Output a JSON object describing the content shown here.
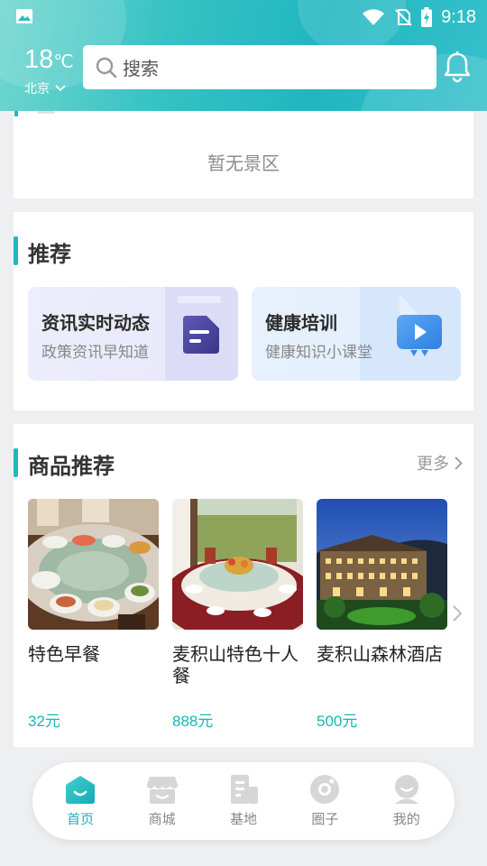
{
  "status_bar": {
    "time": "9:18"
  },
  "weather": {
    "temperature": "18",
    "unit": "℃",
    "city": "北京"
  },
  "search": {
    "placeholder": "搜索"
  },
  "scenic": {
    "empty_text": "暂无景区"
  },
  "recommend": {
    "title": "推荐",
    "items": [
      {
        "title": "资讯实时动态",
        "subtitle": "政策资讯早知道",
        "icon": "news-document-icon"
      },
      {
        "title": "健康培训",
        "subtitle": "健康知识小课堂",
        "icon": "video-play-icon"
      }
    ]
  },
  "products": {
    "title": "商品推荐",
    "more_label": "更多",
    "items": [
      {
        "name": "特色早餐",
        "price": "32元"
      },
      {
        "name": "麦积山特色十人餐",
        "price": "888元"
      },
      {
        "name": "麦积山森林酒店",
        "price": "500元"
      }
    ]
  },
  "tabbar": {
    "items": [
      {
        "label": "首页",
        "icon": "home-icon",
        "active": true
      },
      {
        "label": "商城",
        "icon": "shop-icon",
        "active": false
      },
      {
        "label": "基地",
        "icon": "base-building-icon",
        "active": false
      },
      {
        "label": "圈子",
        "icon": "circle-camera-icon",
        "active": false
      },
      {
        "label": "我的",
        "icon": "profile-icon",
        "active": false
      }
    ]
  },
  "colors": {
    "accent": "#1cb4b8",
    "header": "#20b6c0"
  }
}
